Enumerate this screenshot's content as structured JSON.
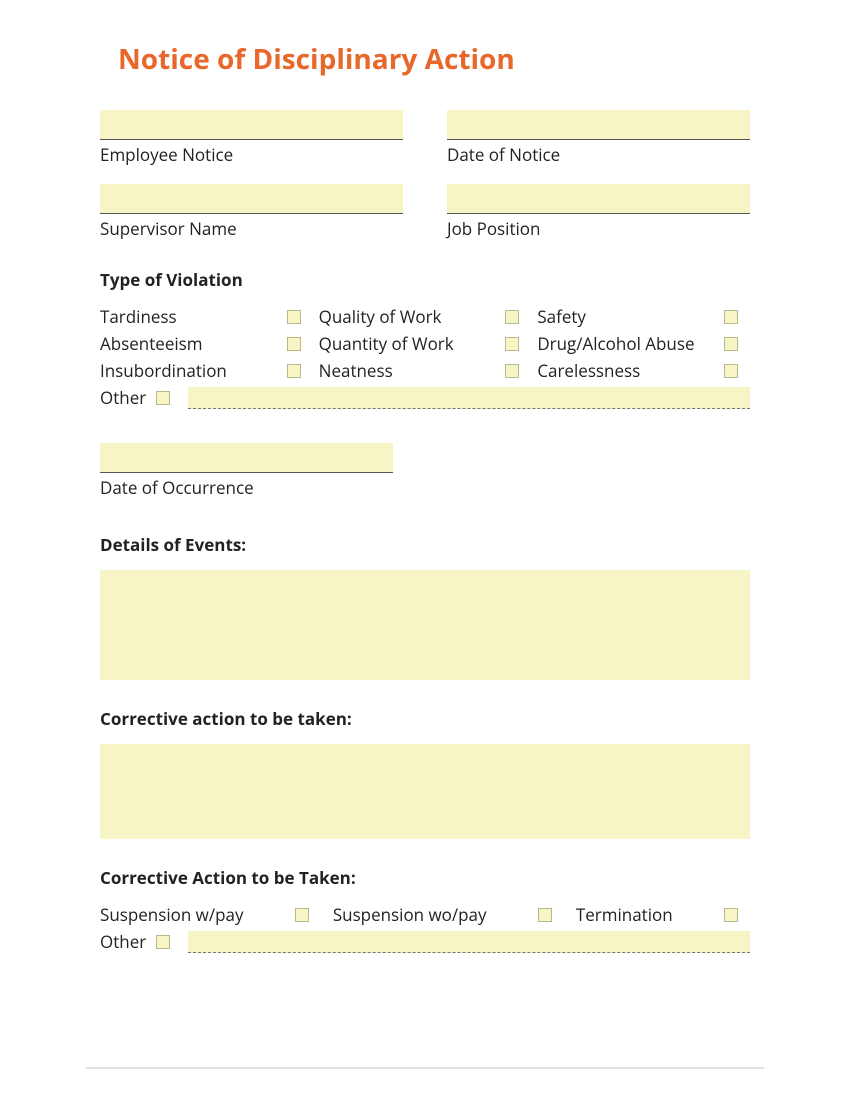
{
  "title": "Notice of Disciplinary Action",
  "fields": {
    "employee_notice": {
      "label": "Employee Notice",
      "value": ""
    },
    "date_of_notice": {
      "label": "Date of Notice",
      "value": ""
    },
    "supervisor_name": {
      "label": "Supervisor Name",
      "value": ""
    },
    "job_position": {
      "label": "Job Position",
      "value": ""
    },
    "date_of_occurrence": {
      "label": "Date of Occurrence",
      "value": ""
    }
  },
  "violation": {
    "heading": "Type of Violation",
    "items": [
      "Tardiness",
      "Quality of Work",
      "Safety",
      "Absenteeism",
      "Quantity of Work",
      "Drug/Alcohol Abuse",
      "Insubordination",
      "Neatness",
      "Carelessness"
    ],
    "other_label": "Other",
    "other_value": ""
  },
  "details": {
    "heading": "Details of Events:",
    "value": ""
  },
  "corrective_text": {
    "heading": "Corrective action to be taken:",
    "value": ""
  },
  "corrective_action": {
    "heading": "Corrective Action to be Taken:",
    "items": [
      "Suspension w/pay",
      "Suspension wo/pay",
      "Termination"
    ],
    "other_label": "Other",
    "other_value": ""
  }
}
